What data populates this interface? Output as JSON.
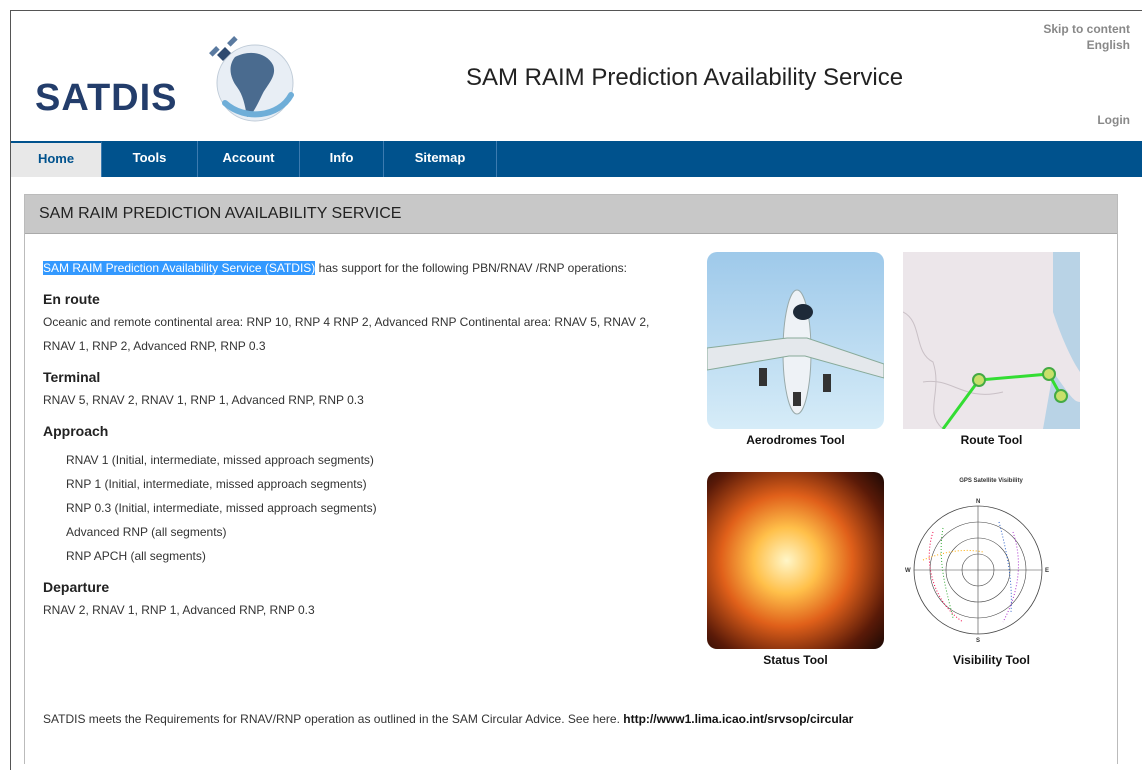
{
  "header": {
    "logo_text": "SATDIS",
    "title": "SAM RAIM Prediction Availability Service",
    "skip_link": "Skip to content",
    "language": "English",
    "login": "Login"
  },
  "nav": {
    "items": [
      {
        "label": "Home"
      },
      {
        "label": "Tools"
      },
      {
        "label": "Account"
      },
      {
        "label": "Info"
      },
      {
        "label": "Sitemap"
      }
    ]
  },
  "panel": {
    "heading": "SAM RAIM PREDICTION AVAILABILITY SERVICE"
  },
  "intro": {
    "highlighted": "SAM RAIM Prediction Availability Service (SATDIS)",
    "rest": " has support for the following PBN/RNAV /RNP operations:"
  },
  "sections": {
    "enroute": {
      "title": "En route",
      "text": "Oceanic and remote continental area: RNP 10, RNP 4 RNP 2, Advanced RNP Continental area: RNAV 5, RNAV 2, RNAV 1, RNP 2, Advanced RNP, RNP 0.3"
    },
    "terminal": {
      "title": "Terminal",
      "text": "RNAV 5, RNAV 2, RNAV 1, RNP 1, Advanced RNP, RNP 0.3"
    },
    "approach": {
      "title": "Approach",
      "items": [
        "RNAV 1 (Initial, intermediate, missed approach segments)",
        "RNP 1 (Initial, intermediate, missed approach segments)",
        "RNP 0.3 (Initial, intermediate, missed approach segments)",
        "Advanced RNP (all segments)",
        "RNP APCH (all segments)"
      ]
    },
    "departure": {
      "title": "Departure",
      "text": "RNAV 2, RNAV 1, RNP 1, Advanced RNP, RNP 0.3"
    }
  },
  "footer": {
    "text": "SATDIS meets the Requirements for RNAV/RNP operation as outlined in the SAM Circular Advice. See here. ",
    "link": "http://www1.lima.icao.int/srvsop/circular"
  },
  "tools": [
    {
      "label": "Aerodromes Tool",
      "icon": "airplane-image"
    },
    {
      "label": "Route Tool",
      "icon": "route-map-image"
    },
    {
      "label": "Status Tool",
      "icon": "sun-image"
    },
    {
      "label": "Visibility Tool",
      "icon": "satellite-visibility-plot"
    }
  ],
  "visibility_plot": {
    "title": "GPS Satellite Visibility",
    "compass": [
      "N",
      "E",
      "S",
      "W"
    ]
  },
  "colors": {
    "nav_bg": "#00528d",
    "highlight": "#3399ff",
    "panel_head": "#c8c8c8"
  }
}
